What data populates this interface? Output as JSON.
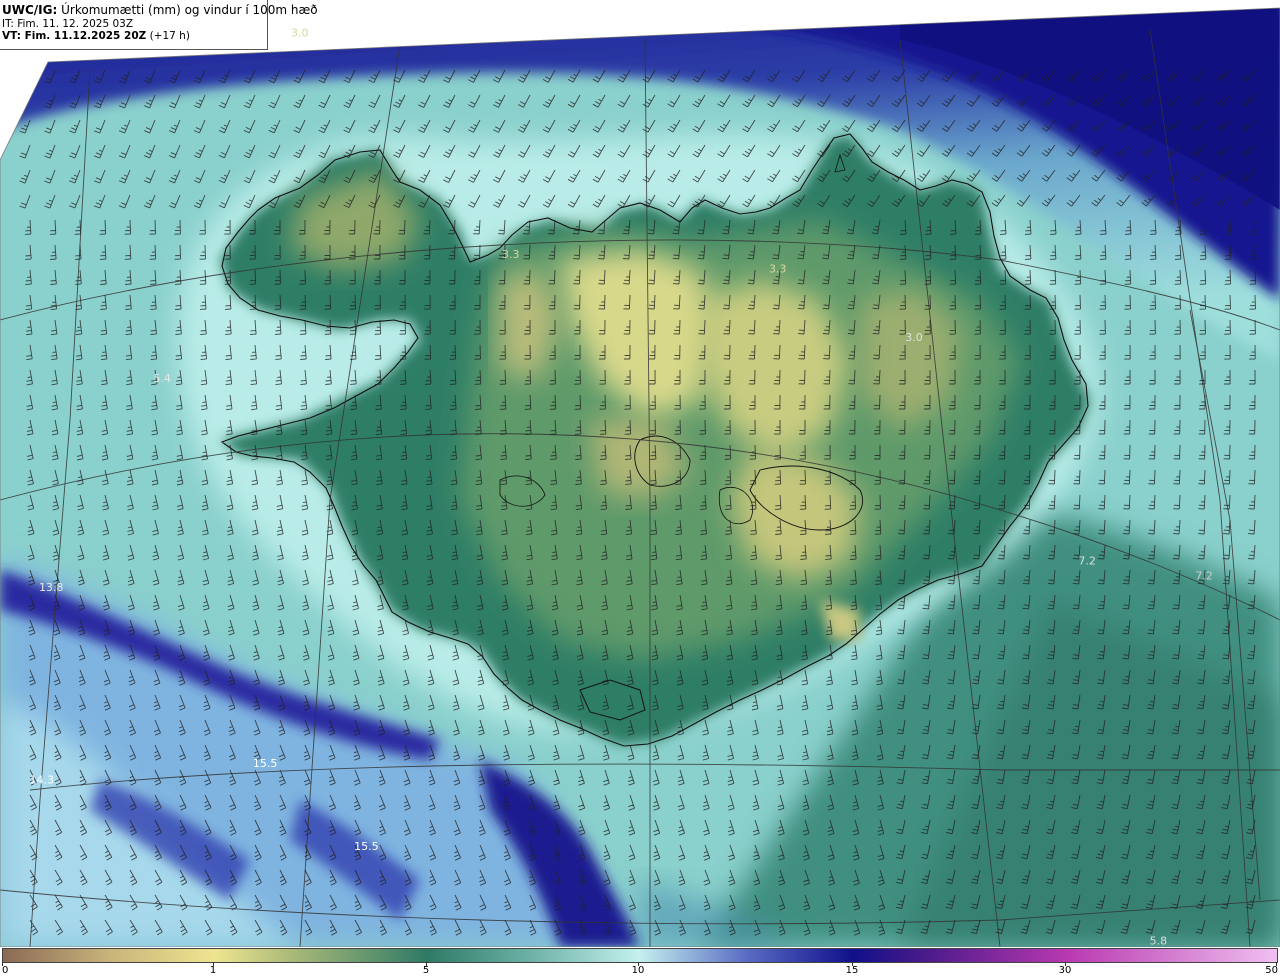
{
  "header": {
    "model": "UWC/IG:",
    "field": " Úrkomumætti (mm) og vindur í 100m hæð",
    "init_prefix": "IT:",
    "init_time": " Fim. 11. 12. 2025 03Z",
    "valid_prefix": "VT:",
    "valid_time": " Fim. 11.12.2025 20Z",
    "lead_time": " (+17 h)"
  },
  "map_labels": [
    {
      "text": "3.0",
      "lon": -22.4,
      "lat": 66.4,
      "color": "#d8d8a0"
    },
    {
      "text": "3.3",
      "lon": -20.0,
      "lat": 65.7,
      "color": "#d8d8a0"
    },
    {
      "text": "3.3",
      "lon": -16.9,
      "lat": 65.65,
      "color": "#d8d8a0"
    },
    {
      "text": "3.0",
      "lon": -15.3,
      "lat": 65.4,
      "color": "#e0e0e0"
    },
    {
      "text": "5.4",
      "lon": -24.1,
      "lat": 65.2,
      "color": "#e8e8e8"
    },
    {
      "text": "7.2",
      "lon": -13.2,
      "lat": 64.6,
      "color": "#dddddd"
    },
    {
      "text": "7.2",
      "lon": -11.8,
      "lat": 64.5,
      "color": "#cccccc"
    },
    {
      "text": "13.8",
      "lon": -25.5,
      "lat": 64.45,
      "color": "#e8e8e8"
    },
    {
      "text": "15.5",
      "lon": -23.0,
      "lat": 63.95,
      "color": "#ffffff"
    },
    {
      "text": "14.3",
      "lon": -25.7,
      "lat": 63.8,
      "color": "#ffffff"
    },
    {
      "text": "15.5",
      "lon": -21.8,
      "lat": 63.7,
      "color": "#ffffff"
    },
    {
      "text": "5.8",
      "lon": -12.2,
      "lat": 63.3,
      "color": "#dddddd"
    },
    {
      "text": "13.7",
      "lon": -24.0,
      "lat": 63.15,
      "color": "#dddddd"
    }
  ],
  "legend": {
    "unit": "mm",
    "ticks": [
      {
        "value": 0,
        "label": "0"
      },
      {
        "value": 1,
        "label": "1"
      },
      {
        "value": 5,
        "label": "5"
      },
      {
        "value": 10,
        "label": "10"
      },
      {
        "value": 15,
        "label": "15"
      },
      {
        "value": 30,
        "label": "30"
      },
      {
        "value": 50,
        "label": "50"
      }
    ],
    "stops": [
      {
        "value": 0,
        "color": "#8b6a55"
      },
      {
        "value": 0.5,
        "color": "#c8b37a"
      },
      {
        "value": 1,
        "color": "#eee58f"
      },
      {
        "value": 2.5,
        "color": "#a8b878"
      },
      {
        "value": 5,
        "color": "#2e7a66"
      },
      {
        "value": 7.5,
        "color": "#6fb3a8"
      },
      {
        "value": 10,
        "color": "#c4f0ee"
      },
      {
        "value": 12.5,
        "color": "#5a6cc4"
      },
      {
        "value": 15,
        "color": "#10108a"
      },
      {
        "value": 20,
        "color": "#4a1a8a"
      },
      {
        "value": 30,
        "color": "#b838b0"
      },
      {
        "value": 50,
        "color": "#f0c0f0"
      }
    ]
  },
  "colors": {
    "deep_blue": "#0e0e80",
    "coast_line": "#111111",
    "grid_line": "#333333",
    "barb": "#222222"
  }
}
